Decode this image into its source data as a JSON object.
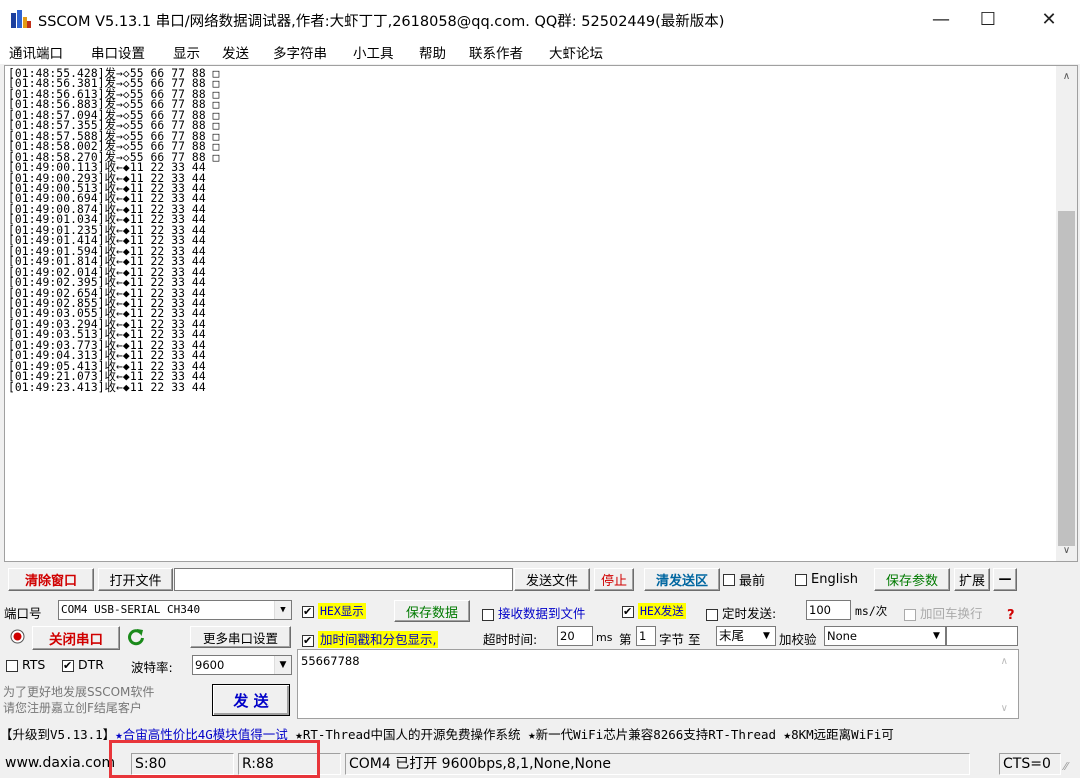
{
  "window": {
    "title": "SSCOM V5.13.1 串口/网络数据调试器,作者:大虾丁丁,2618058@qq.com. QQ群:  52502449(最新版本)",
    "minimize": "—",
    "maximize": "☐",
    "close": "✕"
  },
  "menu": [
    "通讯端口",
    "串口设置",
    "显示",
    "发送",
    "多字符串",
    "小工具",
    "帮助",
    "联系作者",
    "大虾论坛"
  ],
  "log": [
    "[01:48:55.428]发→◇55 66 77 88 □",
    "[01:48:56.381]发→◇55 66 77 88 □",
    "[01:48:56.613]发→◇55 66 77 88 □",
    "[01:48:56.883]发→◇55 66 77 88 □",
    "[01:48:57.094]发→◇55 66 77 88 □",
    "[01:48:57.355]发→◇55 66 77 88 □",
    "[01:48:57.588]发→◇55 66 77 88 □",
    "[01:48:58.002]发→◇55 66 77 88 □",
    "[01:48:58.270]发→◇55 66 77 88 □",
    "[01:49:00.113]收←◆11 22 33 44",
    "[01:49:00.293]收←◆11 22 33 44",
    "[01:49:00.513]收←◆11 22 33 44",
    "[01:49:00.694]收←◆11 22 33 44",
    "[01:49:00.874]收←◆11 22 33 44",
    "[01:49:01.034]收←◆11 22 33 44",
    "[01:49:01.235]收←◆11 22 33 44",
    "[01:49:01.414]收←◆11 22 33 44",
    "[01:49:01.594]收←◆11 22 33 44",
    "[01:49:01.814]收←◆11 22 33 44",
    "[01:49:02.014]收←◆11 22 33 44",
    "[01:49:02.395]收←◆11 22 33 44",
    "[01:49:02.654]收←◆11 22 33 44",
    "[01:49:02.855]收←◆11 22 33 44",
    "[01:49:03.055]收←◆11 22 33 44",
    "[01:49:03.294]收←◆11 22 33 44",
    "[01:49:03.513]收←◆11 22 33 44",
    "[01:49:03.773]收←◆11 22 33 44",
    "[01:49:04.313]收←◆11 22 33 44",
    "[01:49:05.413]收←◆11 22 33 44",
    "[01:49:21.073]收←◆11 22 33 44",
    "[01:49:23.413]收←◆11 22 33 44"
  ],
  "toolbar": {
    "clear_window": "清除窗口",
    "open_file": "打开文件",
    "file_path": "",
    "send_file": "发送文件",
    "stop": "停止",
    "clear_send": "清发送区",
    "topmost": "最前",
    "english": "English",
    "save_params": "保存参数",
    "expand": "扩展",
    "collapse": "—"
  },
  "port": {
    "label": "端口号",
    "value": "COM4 USB-SERIAL CH340",
    "close_port": "关闭串口",
    "more_settings": "更多串口设置",
    "rts": "RTS",
    "dtr": "DTR",
    "baud_label": "波特率:",
    "baud_value": "9600",
    "promo": "为了更好地发展SSCOM软件\n请您注册嘉立创F结尾客户",
    "send_button": "发 送"
  },
  "options": {
    "hex_display": "HEX显示",
    "save_data": "保存数据",
    "recv_to_file": "接收数据到文件",
    "hex_send": "HEX发送",
    "timed_send": "定时发送:",
    "interval": "100",
    "interval_unit": "ms/次",
    "add_crlf": "加回车换行",
    "timestamp": "加时间戳和分包显示,",
    "timeout_label": "超时时间:",
    "timeout_value": "20",
    "timeout_unit": "ms",
    "byte_prefix": "第",
    "byte_index": "1",
    "byte_label": "字节 至",
    "end_value": "末尾",
    "checksum_label": "加校验",
    "checksum_value": "None"
  },
  "send_data": "55667788",
  "marquee": "【升级到V5.13.1】★合宙高性价比4G模块值得一试 ★RT-Thread中国人的开源免费操作系统 ★新一代WiFi芯片兼容8266支持RT-Thread ★8KM远距离WiFi可",
  "status": {
    "website": "www.daxia.com",
    "sent": "S:80",
    "received": "R:88",
    "port_status": "COM4 已打开  9600bps,8,1,None,None",
    "cts": "CTS=0"
  },
  "colors": {
    "accent_red": "#d00000",
    "accent_blue": "#0000c8",
    "accent_green": "#007a00",
    "highlight_yellow": "#ffff00",
    "annotation_red": "#e8353a"
  }
}
